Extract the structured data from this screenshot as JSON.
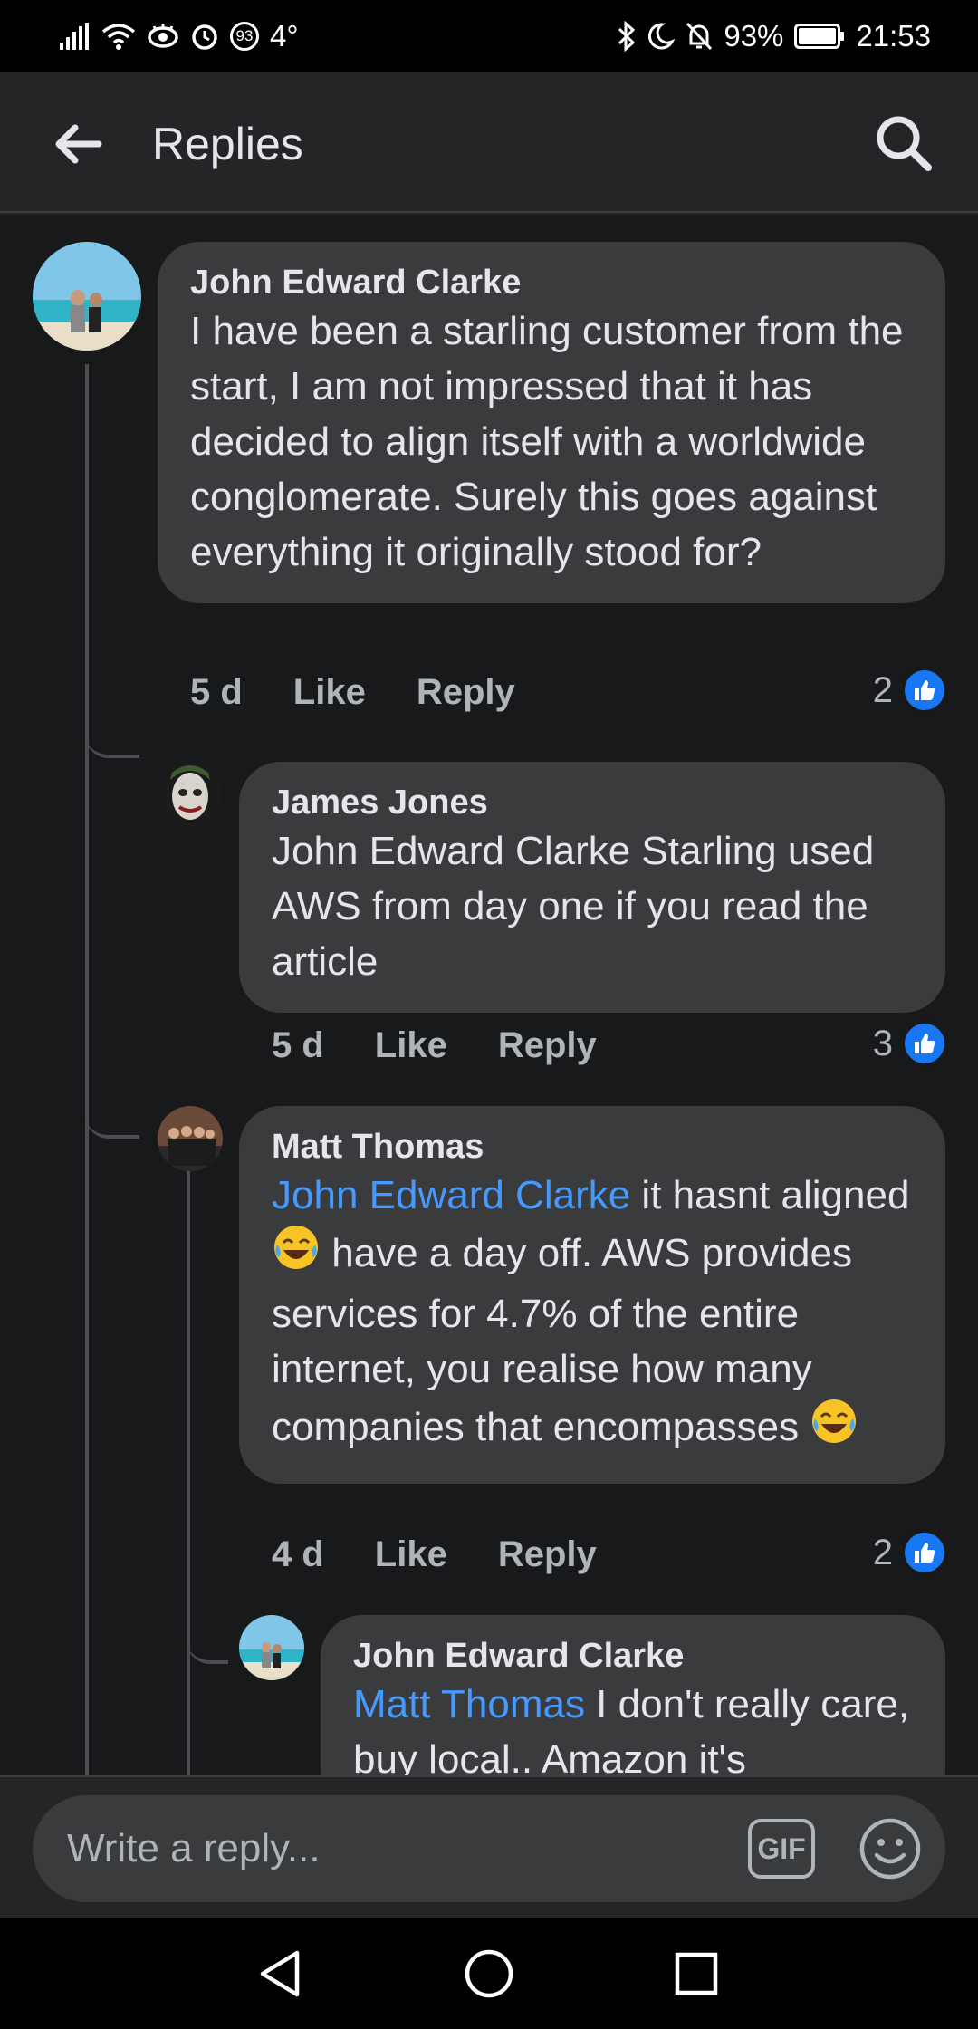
{
  "status_bar": {
    "signal_icon": "signal-icon",
    "wifi_icon": "wifi-icon",
    "eye_icon": "eye-comfort-icon",
    "alarm_icon": "alarm-icon",
    "notification_count": "93",
    "temperature": "4°",
    "bluetooth_icon": "bluetooth-icon",
    "moon_icon": "do-not-disturb-icon",
    "mute_icon": "notifications-off-icon",
    "battery": "93%",
    "time": "21:53"
  },
  "header": {
    "title": "Replies",
    "back_icon": "back-arrow-icon",
    "search_icon": "search-icon"
  },
  "comments": [
    {
      "author": "John Edward Clarke",
      "text": "I have been a starling customer from the start, I am not impressed that it has decided to align itself with a worldwide conglomerate. Surely this goes against everything it originally stood for?",
      "time": "5 d",
      "like_label": "Like",
      "reply_label": "Reply",
      "like_count": "2"
    },
    {
      "author": "James Jones",
      "text": "John Edward Clarke Starling used AWS from day one if you read the article",
      "time": "5 d",
      "like_label": "Like",
      "reply_label": "Reply",
      "like_count": "3"
    },
    {
      "author": "Matt Thomas",
      "mention": "John Edward Clarke",
      "text_1": " it hasnt aligned ",
      "text_2": " have a day off. AWS provides services for 4.7% of the entire internet, you realise how many companies that encompasses ",
      "emoji": "tears-of-joy-emoji",
      "time": "4 d",
      "like_label": "Like",
      "reply_label": "Reply",
      "like_count": "2"
    },
    {
      "author": "John Edward Clarke",
      "mention": "Matt Thomas",
      "text": " I don't really care, buy local.. Amazon it's"
    }
  ],
  "composer": {
    "placeholder": "Write a reply...",
    "gif_label": "GIF",
    "emoji_icon": "smiley-icon"
  },
  "nav_bar": {
    "back_icon": "nav-back-icon",
    "home_icon": "nav-home-icon",
    "recents_icon": "nav-recents-icon"
  },
  "colors": {
    "background": "#18191a",
    "bubble": "#3a3b3c",
    "mention": "#4599ff",
    "like_badge": "#1877f2"
  }
}
